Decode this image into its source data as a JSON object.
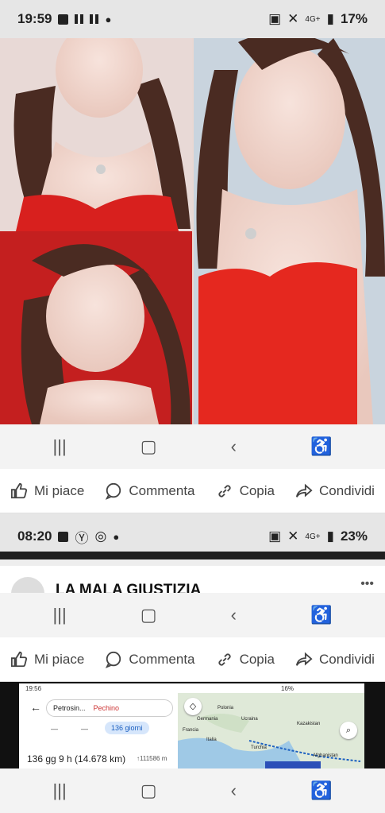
{
  "status_top": {
    "time": "19:59",
    "network": "4G+",
    "battery": "17%"
  },
  "status_mid": {
    "time": "08:20",
    "network": "4G+",
    "battery": "23%"
  },
  "post_actions": {
    "like": "Mi piace",
    "comment": "Commenta",
    "copy": "Copia",
    "share": "Condividi"
  },
  "page_header": {
    "name": "LA  MALA GIUSTIZIA",
    "more": "•••"
  },
  "mini_maps": {
    "time": "19:56",
    "battery": "16%",
    "from": "Petrosin...",
    "to": "Pechino",
    "mode_time": "136 giorni",
    "route_summary": "136 gg 9 h (14.678 km)",
    "steps": "↑111586 m",
    "map_labels": [
      "Polonia",
      "Germania",
      "Ucraina",
      "Francia",
      "Italia",
      "Turchia",
      "Kazakistan",
      "Afghanistan"
    ],
    "car_label": "—",
    "transit_label": "—"
  }
}
